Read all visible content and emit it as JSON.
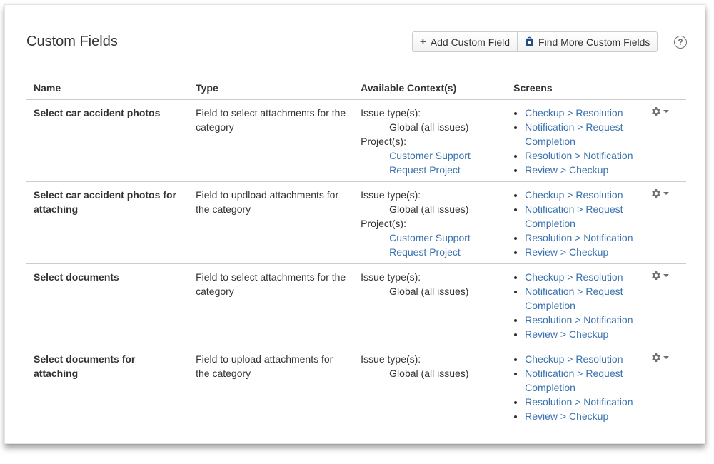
{
  "page": {
    "title": "Custom Fields"
  },
  "toolbar": {
    "add_label": "Add Custom Field",
    "find_label": "Find More Custom Fields",
    "add_icon": "plus-icon",
    "find_icon": "marketplace-bag-icon",
    "help_icon": "help-icon"
  },
  "table": {
    "headers": {
      "name": "Name",
      "type": "Type",
      "context": "Available Context(s)",
      "screens": "Screens"
    },
    "rows": [
      {
        "name": "Select car accident photos",
        "type": "Field to select attachments for the category",
        "issue_types_label": "Issue type(s):",
        "issue_types_value": "Global (all issues)",
        "projects_label": "Project(s):",
        "projects": [
          "Customer Support",
          "Request Project"
        ],
        "screens": [
          "Checkup > Resolution",
          "Notification > Request Completion",
          "Resolution > Notification",
          "Review > Checkup"
        ]
      },
      {
        "name": "Select car accident photos for attaching",
        "type": "Field to updload attachments for the category",
        "issue_types_label": "Issue type(s):",
        "issue_types_value": "Global (all issues)",
        "projects_label": "Project(s):",
        "projects": [
          "Customer Support",
          "Request Project"
        ],
        "screens": [
          "Checkup > Resolution",
          "Notification > Request Completion",
          "Resolution > Notification",
          "Review > Checkup"
        ]
      },
      {
        "name": "Select documents",
        "type": "Field to select attachments for the category",
        "issue_types_label": "Issue type(s):",
        "issue_types_value": "Global (all issues)",
        "projects_label": "",
        "projects": [],
        "screens": [
          "Checkup > Resolution",
          "Notification > Request Completion",
          "Resolution > Notification",
          "Review > Checkup"
        ]
      },
      {
        "name": "Select documents for attaching",
        "type": "Field to upload attachments for the category",
        "issue_types_label": "Issue type(s):",
        "issue_types_value": "Global (all issues)",
        "projects_label": "",
        "projects": [],
        "screens": [
          "Checkup > Resolution",
          "Notification > Request Completion",
          "Resolution > Notification",
          "Review > Checkup"
        ]
      }
    ]
  },
  "colors": {
    "link": "#3b73af",
    "text": "#333333",
    "border": "#cccccc"
  }
}
